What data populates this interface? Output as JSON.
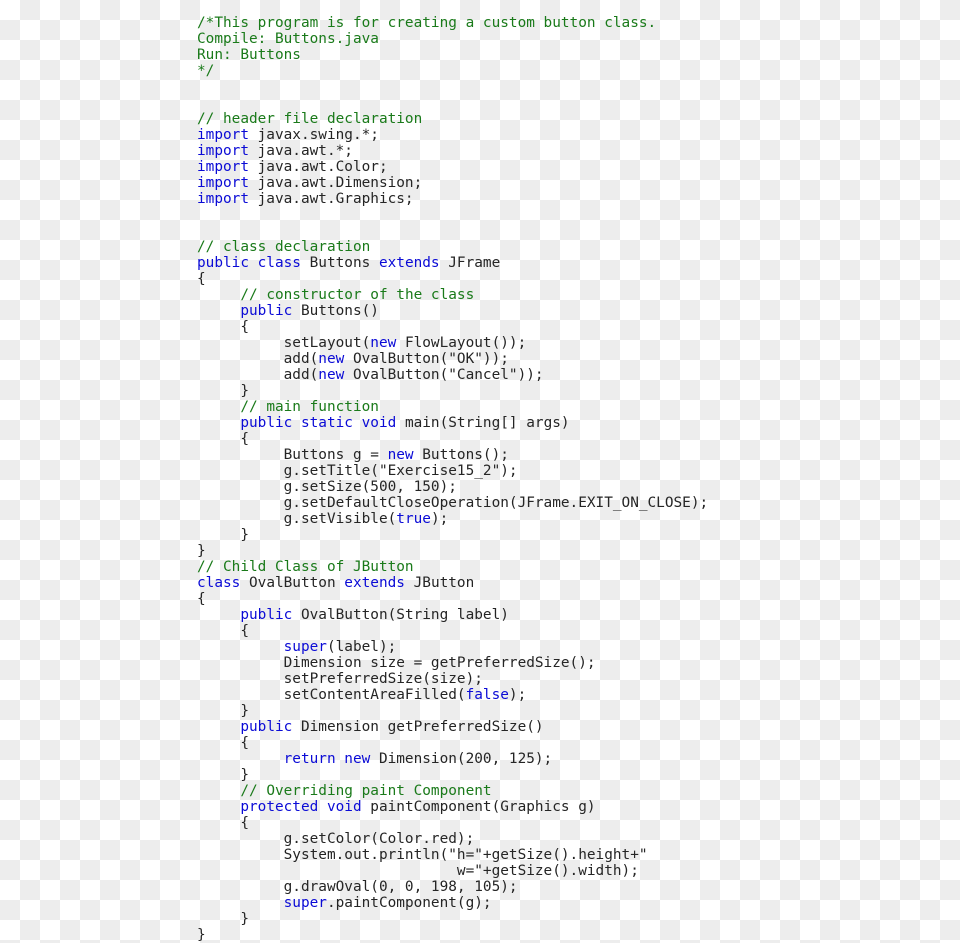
{
  "document": {
    "kind": "java-source-code",
    "language": "Java",
    "file": "Buttons.java",
    "background": "transparent-checkerboard"
  },
  "colors": {
    "plain": "#252525",
    "comment": "#1a7a1a",
    "keyword": "#0b0bd6",
    "checker_light": "#ffffff",
    "checker_dark": "#ededed"
  },
  "code": {
    "lines": [
      {
        "indent": 0,
        "tokens": [
          {
            "t": "/*This program is for creating a custom button class.",
            "c": "comment"
          }
        ]
      },
      {
        "indent": 0,
        "tokens": [
          {
            "t": "Compile: Buttons.java",
            "c": "comment"
          }
        ]
      },
      {
        "indent": 0,
        "tokens": [
          {
            "t": "Run: Buttons",
            "c": "comment"
          }
        ]
      },
      {
        "indent": 0,
        "tokens": [
          {
            "t": "*/",
            "c": "comment"
          }
        ]
      },
      {
        "indent": 0,
        "tokens": []
      },
      {
        "indent": 0,
        "tokens": []
      },
      {
        "indent": 0,
        "tokens": [
          {
            "t": "// header file declaration",
            "c": "comment"
          }
        ]
      },
      {
        "indent": 0,
        "tokens": [
          {
            "t": "import",
            "c": "keyword"
          },
          {
            "t": " javax.swing.*;",
            "c": "plain"
          }
        ]
      },
      {
        "indent": 0,
        "tokens": [
          {
            "t": "import",
            "c": "keyword"
          },
          {
            "t": " java.awt.*;",
            "c": "plain"
          }
        ]
      },
      {
        "indent": 0,
        "tokens": [
          {
            "t": "import",
            "c": "keyword"
          },
          {
            "t": " java.awt.Color;",
            "c": "plain"
          }
        ]
      },
      {
        "indent": 0,
        "tokens": [
          {
            "t": "import",
            "c": "keyword"
          },
          {
            "t": " java.awt.Dimension;",
            "c": "plain"
          }
        ]
      },
      {
        "indent": 0,
        "tokens": [
          {
            "t": "import",
            "c": "keyword"
          },
          {
            "t": " java.awt.Graphics;",
            "c": "plain"
          }
        ]
      },
      {
        "indent": 0,
        "tokens": []
      },
      {
        "indent": 0,
        "tokens": []
      },
      {
        "indent": 0,
        "tokens": [
          {
            "t": "// class declaration",
            "c": "comment"
          }
        ]
      },
      {
        "indent": 0,
        "tokens": [
          {
            "t": "public class",
            "c": "keyword"
          },
          {
            "t": " Buttons ",
            "c": "plain"
          },
          {
            "t": "extends",
            "c": "keyword"
          },
          {
            "t": " JFrame",
            "c": "plain"
          }
        ]
      },
      {
        "indent": 0,
        "tokens": [
          {
            "t": "{",
            "c": "plain"
          }
        ]
      },
      {
        "indent": 0,
        "tokens": [
          {
            "t": "     ",
            "c": "plain"
          },
          {
            "t": "// constructor of the class",
            "c": "comment"
          }
        ]
      },
      {
        "indent": 0,
        "tokens": [
          {
            "t": "     ",
            "c": "plain"
          },
          {
            "t": "public",
            "c": "keyword"
          },
          {
            "t": " Buttons()",
            "c": "plain"
          }
        ]
      },
      {
        "indent": 0,
        "tokens": [
          {
            "t": "     {",
            "c": "plain"
          }
        ]
      },
      {
        "indent": 0,
        "tokens": [
          {
            "t": "          setLayout(",
            "c": "plain"
          },
          {
            "t": "new",
            "c": "keyword"
          },
          {
            "t": " FlowLayout());",
            "c": "plain"
          }
        ]
      },
      {
        "indent": 0,
        "tokens": [
          {
            "t": "          add(",
            "c": "plain"
          },
          {
            "t": "new",
            "c": "keyword"
          },
          {
            "t": " OvalButton(\"OK\"));",
            "c": "plain"
          }
        ]
      },
      {
        "indent": 0,
        "tokens": [
          {
            "t": "          add(",
            "c": "plain"
          },
          {
            "t": "new",
            "c": "keyword"
          },
          {
            "t": " OvalButton(\"Cancel\"));",
            "c": "plain"
          }
        ]
      },
      {
        "indent": 0,
        "tokens": [
          {
            "t": "     }",
            "c": "plain"
          }
        ]
      },
      {
        "indent": 0,
        "tokens": [
          {
            "t": "     ",
            "c": "plain"
          },
          {
            "t": "// main function",
            "c": "comment"
          }
        ]
      },
      {
        "indent": 0,
        "tokens": [
          {
            "t": "     ",
            "c": "plain"
          },
          {
            "t": "public static void",
            "c": "keyword"
          },
          {
            "t": " main(String[] args)",
            "c": "plain"
          }
        ]
      },
      {
        "indent": 0,
        "tokens": [
          {
            "t": "     {",
            "c": "plain"
          }
        ]
      },
      {
        "indent": 0,
        "tokens": [
          {
            "t": "          Buttons g = ",
            "c": "plain"
          },
          {
            "t": "new",
            "c": "keyword"
          },
          {
            "t": " Buttons();",
            "c": "plain"
          }
        ]
      },
      {
        "indent": 0,
        "tokens": [
          {
            "t": "          g.setTitle(\"Exercise15_2\");",
            "c": "plain"
          }
        ]
      },
      {
        "indent": 0,
        "tokens": [
          {
            "t": "          g.setSize(500, 150);",
            "c": "plain"
          }
        ]
      },
      {
        "indent": 0,
        "tokens": [
          {
            "t": "          g.setDefaultCloseOperation(JFrame.EXIT_ON_CLOSE);",
            "c": "plain"
          }
        ]
      },
      {
        "indent": 0,
        "tokens": [
          {
            "t": "          g.setVisible(",
            "c": "plain"
          },
          {
            "t": "true",
            "c": "keyword"
          },
          {
            "t": ");",
            "c": "plain"
          }
        ]
      },
      {
        "indent": 0,
        "tokens": [
          {
            "t": "     }",
            "c": "plain"
          }
        ]
      },
      {
        "indent": 0,
        "tokens": [
          {
            "t": "}",
            "c": "plain"
          }
        ]
      },
      {
        "indent": 0,
        "tokens": [
          {
            "t": "// Child Class of JButton",
            "c": "comment"
          }
        ]
      },
      {
        "indent": 0,
        "tokens": [
          {
            "t": "class",
            "c": "keyword"
          },
          {
            "t": " OvalButton ",
            "c": "plain"
          },
          {
            "t": "extends",
            "c": "keyword"
          },
          {
            "t": " JButton",
            "c": "plain"
          }
        ]
      },
      {
        "indent": 0,
        "tokens": [
          {
            "t": "{",
            "c": "plain"
          }
        ]
      },
      {
        "indent": 0,
        "tokens": [
          {
            "t": "     ",
            "c": "plain"
          },
          {
            "t": "public",
            "c": "keyword"
          },
          {
            "t": " OvalButton(String label)",
            "c": "plain"
          }
        ]
      },
      {
        "indent": 0,
        "tokens": [
          {
            "t": "     {",
            "c": "plain"
          }
        ]
      },
      {
        "indent": 0,
        "tokens": [
          {
            "t": "          ",
            "c": "plain"
          },
          {
            "t": "super",
            "c": "keyword"
          },
          {
            "t": "(label);",
            "c": "plain"
          }
        ]
      },
      {
        "indent": 0,
        "tokens": [
          {
            "t": "          Dimension size = getPreferredSize();",
            "c": "plain"
          }
        ]
      },
      {
        "indent": 0,
        "tokens": [
          {
            "t": "          setPreferredSize(size);",
            "c": "plain"
          }
        ]
      },
      {
        "indent": 0,
        "tokens": [
          {
            "t": "          setContentAreaFilled(",
            "c": "plain"
          },
          {
            "t": "false",
            "c": "keyword"
          },
          {
            "t": ");",
            "c": "plain"
          }
        ]
      },
      {
        "indent": 0,
        "tokens": [
          {
            "t": "     }",
            "c": "plain"
          }
        ]
      },
      {
        "indent": 0,
        "tokens": [
          {
            "t": "     ",
            "c": "plain"
          },
          {
            "t": "public",
            "c": "keyword"
          },
          {
            "t": " Dimension getPreferredSize()",
            "c": "plain"
          }
        ]
      },
      {
        "indent": 0,
        "tokens": [
          {
            "t": "     {",
            "c": "plain"
          }
        ]
      },
      {
        "indent": 0,
        "tokens": [
          {
            "t": "          ",
            "c": "plain"
          },
          {
            "t": "return new",
            "c": "keyword"
          },
          {
            "t": " Dimension(200, 125);",
            "c": "plain"
          }
        ]
      },
      {
        "indent": 0,
        "tokens": [
          {
            "t": "     }",
            "c": "plain"
          }
        ]
      },
      {
        "indent": 0,
        "tokens": [
          {
            "t": "     ",
            "c": "plain"
          },
          {
            "t": "// Overriding paint Component",
            "c": "comment"
          }
        ]
      },
      {
        "indent": 0,
        "tokens": [
          {
            "t": "     ",
            "c": "plain"
          },
          {
            "t": "protected void",
            "c": "keyword"
          },
          {
            "t": " paintComponent(Graphics g)",
            "c": "plain"
          }
        ]
      },
      {
        "indent": 0,
        "tokens": [
          {
            "t": "     {",
            "c": "plain"
          }
        ]
      },
      {
        "indent": 0,
        "tokens": [
          {
            "t": "          g.setColor(Color.red);",
            "c": "plain"
          }
        ]
      },
      {
        "indent": 0,
        "tokens": [
          {
            "t": "          System.out.println(\"h=\"+getSize().height+\"",
            "c": "plain"
          }
        ]
      },
      {
        "indent": 0,
        "tokens": [
          {
            "t": "                              w=\"+getSize().width);",
            "c": "plain"
          }
        ]
      },
      {
        "indent": 0,
        "tokens": [
          {
            "t": "          g.drawOval(0, 0, 198, 105);",
            "c": "plain"
          }
        ]
      },
      {
        "indent": 0,
        "tokens": [
          {
            "t": "          ",
            "c": "plain"
          },
          {
            "t": "super",
            "c": "keyword"
          },
          {
            "t": ".paintComponent(g);",
            "c": "plain"
          }
        ]
      },
      {
        "indent": 0,
        "tokens": [
          {
            "t": "     }",
            "c": "plain"
          }
        ]
      },
      {
        "indent": 0,
        "tokens": [
          {
            "t": "}",
            "c": "plain"
          }
        ]
      }
    ]
  }
}
